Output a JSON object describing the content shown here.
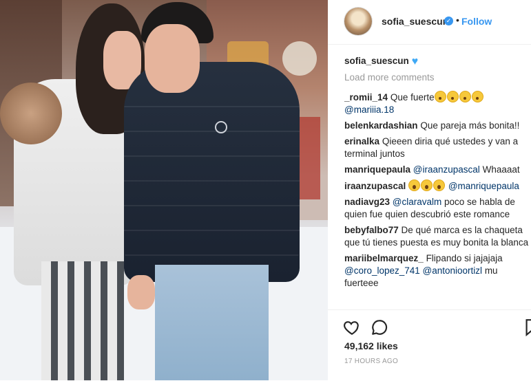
{
  "post": {
    "username": "sofia_suescun",
    "follow_label": "Follow",
    "separator": "•",
    "caption_username": "sofia_suescun",
    "load_more": "Load more comments",
    "likes": "49,162 likes",
    "time": "17 HOURS AGO"
  },
  "comments": [
    {
      "user": "_romii_14",
      "pre": "Que fuerte",
      "emoji": [
        "surprised",
        "surprised",
        "surprised",
        "surprised"
      ],
      "mention": "@mariiia.18",
      "post": ""
    },
    {
      "user": "belenkardashian",
      "pre": "Que pareja más bonita!!",
      "emoji": [],
      "mention": "",
      "post": ""
    },
    {
      "user": "erinalka",
      "pre": "Qieeen diria qué ustedes y van a terminal juntos",
      "emoji": [],
      "mention": "",
      "post": ""
    },
    {
      "user": "manriquepaula",
      "pre": "",
      "emoji": [],
      "mention": "@iraanzupascal",
      "post": "Whaaaat"
    },
    {
      "user": "iraanzupascal",
      "pre": "",
      "emoji": [
        "scream",
        "scream",
        "scream"
      ],
      "mention": "@manriquepaula",
      "post": ""
    },
    {
      "user": "nadiavg23",
      "pre": "",
      "emoji": [],
      "mention": "@claravalm",
      "post": "poco se habla de quien fue quien descubrió este romance"
    },
    {
      "user": "bebyfalbo77",
      "pre": "De qué marca es la chaqueta que tú tienes puesta es muy bonita la blanca",
      "emoji": [],
      "mention": "",
      "post": ""
    },
    {
      "user": "mariibelmarquez_",
      "pre": "Flipando si jajajaja",
      "emoji": [],
      "mention": "@coro_lopez_741",
      "mention2": "@antonioortizl",
      "post": "mu fuerteee"
    }
  ],
  "icons": {
    "verified": "verified-badge-icon",
    "heart_caption": "blue-heart-emoji",
    "like": "heart-outline-icon",
    "comment": "speech-bubble-icon",
    "save": "bookmark-icon"
  },
  "colors": {
    "accent": "#3897f0",
    "text": "#262626",
    "muted": "#999999"
  }
}
